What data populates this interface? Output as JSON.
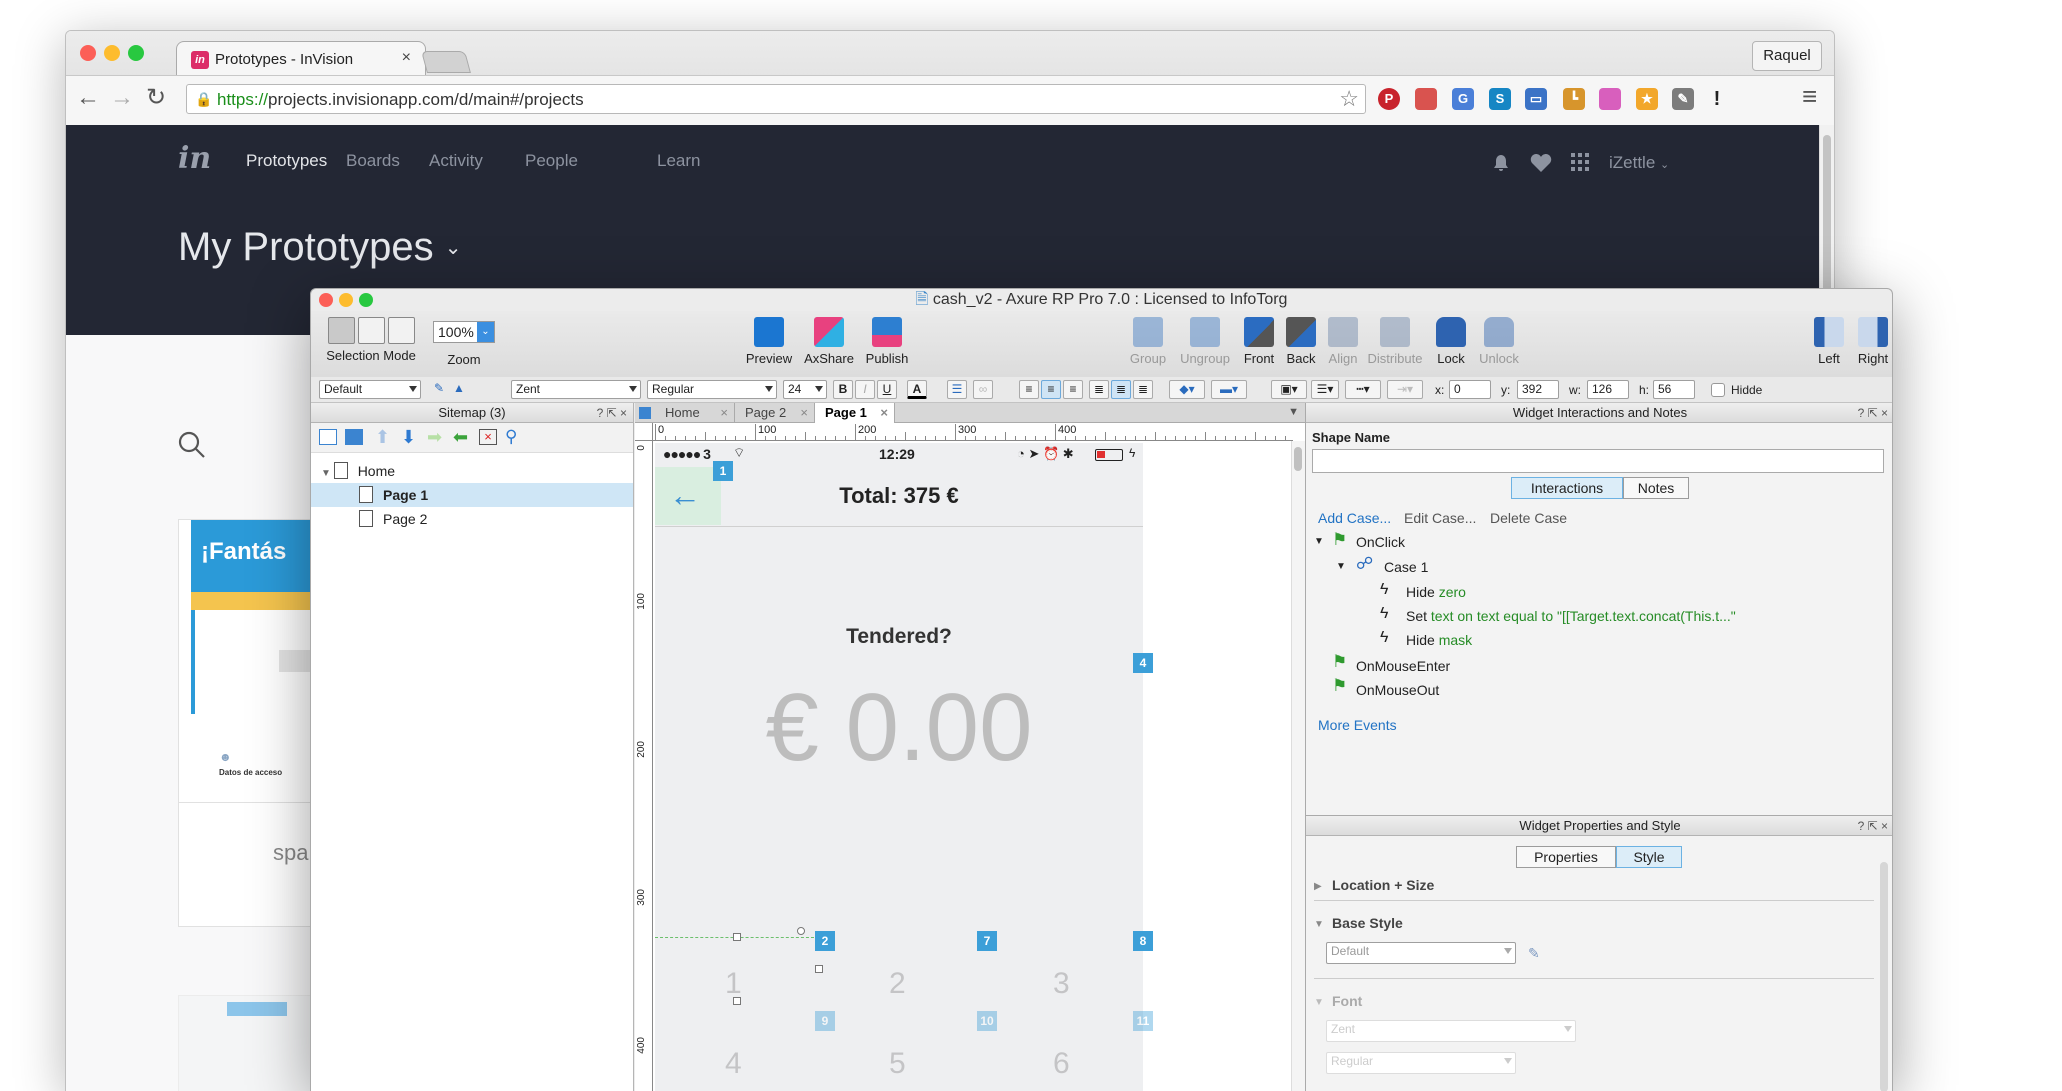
{
  "browser": {
    "tab_title": "Prototypes - InVision",
    "tab_close": "×",
    "user_button": "Raquel",
    "url_scheme": "https://",
    "url_rest": "projects.invisionapp.com/d/main#/projects",
    "back": "←",
    "forward": "→",
    "reload": "↻",
    "star": "☆",
    "menu": "≡",
    "extensions": [
      {
        "name": "pinterest",
        "symbol": "P",
        "color": "#c8232c"
      },
      {
        "name": "bookmark",
        "symbol": "",
        "color": "#d9534f"
      },
      {
        "name": "translate",
        "symbol": "G",
        "color": "#4a7fd8"
      },
      {
        "name": "skype",
        "symbol": "S",
        "color": "#1686c4"
      },
      {
        "name": "screen",
        "symbol": "▭",
        "color": "#3b73c6"
      },
      {
        "name": "ruler",
        "symbol": "┗",
        "color": "#d7952c"
      },
      {
        "name": "gradient",
        "symbol": "",
        "color": "#d85fbd"
      },
      {
        "name": "star-ext",
        "symbol": "★",
        "color": "#f2a72b"
      },
      {
        "name": "eyedropper",
        "symbol": "✎",
        "color": "#7c7c7c"
      },
      {
        "name": "alert",
        "symbol": "!",
        "color": "#222222"
      }
    ]
  },
  "invision": {
    "logo": "in",
    "nav": [
      "Prototypes",
      "Boards",
      "Activity",
      "People",
      "Learn"
    ],
    "account": "iZettle",
    "page_title": "My Prototypes",
    "card_heading": "¡Fantás",
    "card_sub": "Datos de acceso",
    "card_footer": "spa"
  },
  "axure": {
    "window_title": "cash_v2 - Axure RP Pro 7.0 : Licensed to InfoTorg",
    "toolbar": {
      "selection_mode": "Selection Mode",
      "zoom_value": "100%",
      "zoom_label": "Zoom",
      "preview": "Preview",
      "axshare": "AxShare",
      "publish": "Publish",
      "group": "Group",
      "ungroup": "Ungroup",
      "front": "Front",
      "back": "Back",
      "align": "Align",
      "distribute": "Distribute",
      "lock": "Lock",
      "unlock": "Unlock",
      "left": "Left",
      "right": "Right"
    },
    "format": {
      "style": "Default",
      "font": "Zent",
      "weight": "Regular",
      "size": "24",
      "x_label": "x:",
      "x": "0",
      "y_label": "y:",
      "y": "392",
      "w_label": "w:",
      "w": "126",
      "h_label": "h:",
      "h": "56",
      "hidden": "Hidde",
      "bold": "B",
      "italic": "I",
      "underline": "U",
      "text_color": "A"
    },
    "sitemap": {
      "title": "Sitemap (3)",
      "controls": "? ⇱ ×",
      "pages": [
        {
          "label": "Home",
          "level": 0
        },
        {
          "label": "Page 1",
          "level": 1,
          "selected": true
        },
        {
          "label": "Page 2",
          "level": 1
        }
      ]
    },
    "tabs": [
      {
        "label": "Home",
        "x": "×"
      },
      {
        "label": "Page 2",
        "x": "×"
      },
      {
        "label": "Page 1",
        "x": "×",
        "active": true
      }
    ],
    "ruler_top": [
      "0",
      "100",
      "200",
      "300",
      "400"
    ],
    "ruler_left": [
      "0",
      "100",
      "200",
      "300",
      "400"
    ],
    "phone": {
      "signal": "●●●●● 3",
      "time": "12:29",
      "back_arrow": "←",
      "total": "Total: 375 €",
      "tendered": "Tendered?",
      "amount": "€ 0.00",
      "keys": [
        "1",
        "2",
        "3",
        "4",
        "5",
        "6"
      ],
      "badges": [
        "1",
        "4",
        "2",
        "7",
        "8",
        "9",
        "10",
        "11"
      ]
    },
    "interactions": {
      "title": "Widget Interactions and Notes",
      "controls": "? ⇱ ×",
      "shape_name_label": "Shape Name",
      "shape_name_value": "",
      "tab_interactions": "Interactions",
      "tab_notes": "Notes",
      "add_case": "Add Case...",
      "edit_case": "Edit Case...",
      "delete_case": "Delete Case",
      "onclick": "OnClick",
      "case1": "Case 1",
      "action1_verb": "Hide",
      "action1_target": "zero",
      "action2_verb": "Set",
      "action2_target": "text on text equal to \"[[Target.text.concat(This.t...\"",
      "action3_verb": "Hide",
      "action3_target": "mask",
      "onmouseenter": "OnMouseEnter",
      "onmouseout": "OnMouseOut",
      "more_events": "More Events"
    },
    "properties": {
      "title": "Widget Properties and Style",
      "controls": "? ⇱ ×",
      "tab_properties": "Properties",
      "tab_style": "Style",
      "location_size": "Location + Size",
      "base_style": "Base Style",
      "base_style_value": "Default",
      "font_section": "Font",
      "font_value": "Zent",
      "font_weight": "Regular"
    }
  }
}
